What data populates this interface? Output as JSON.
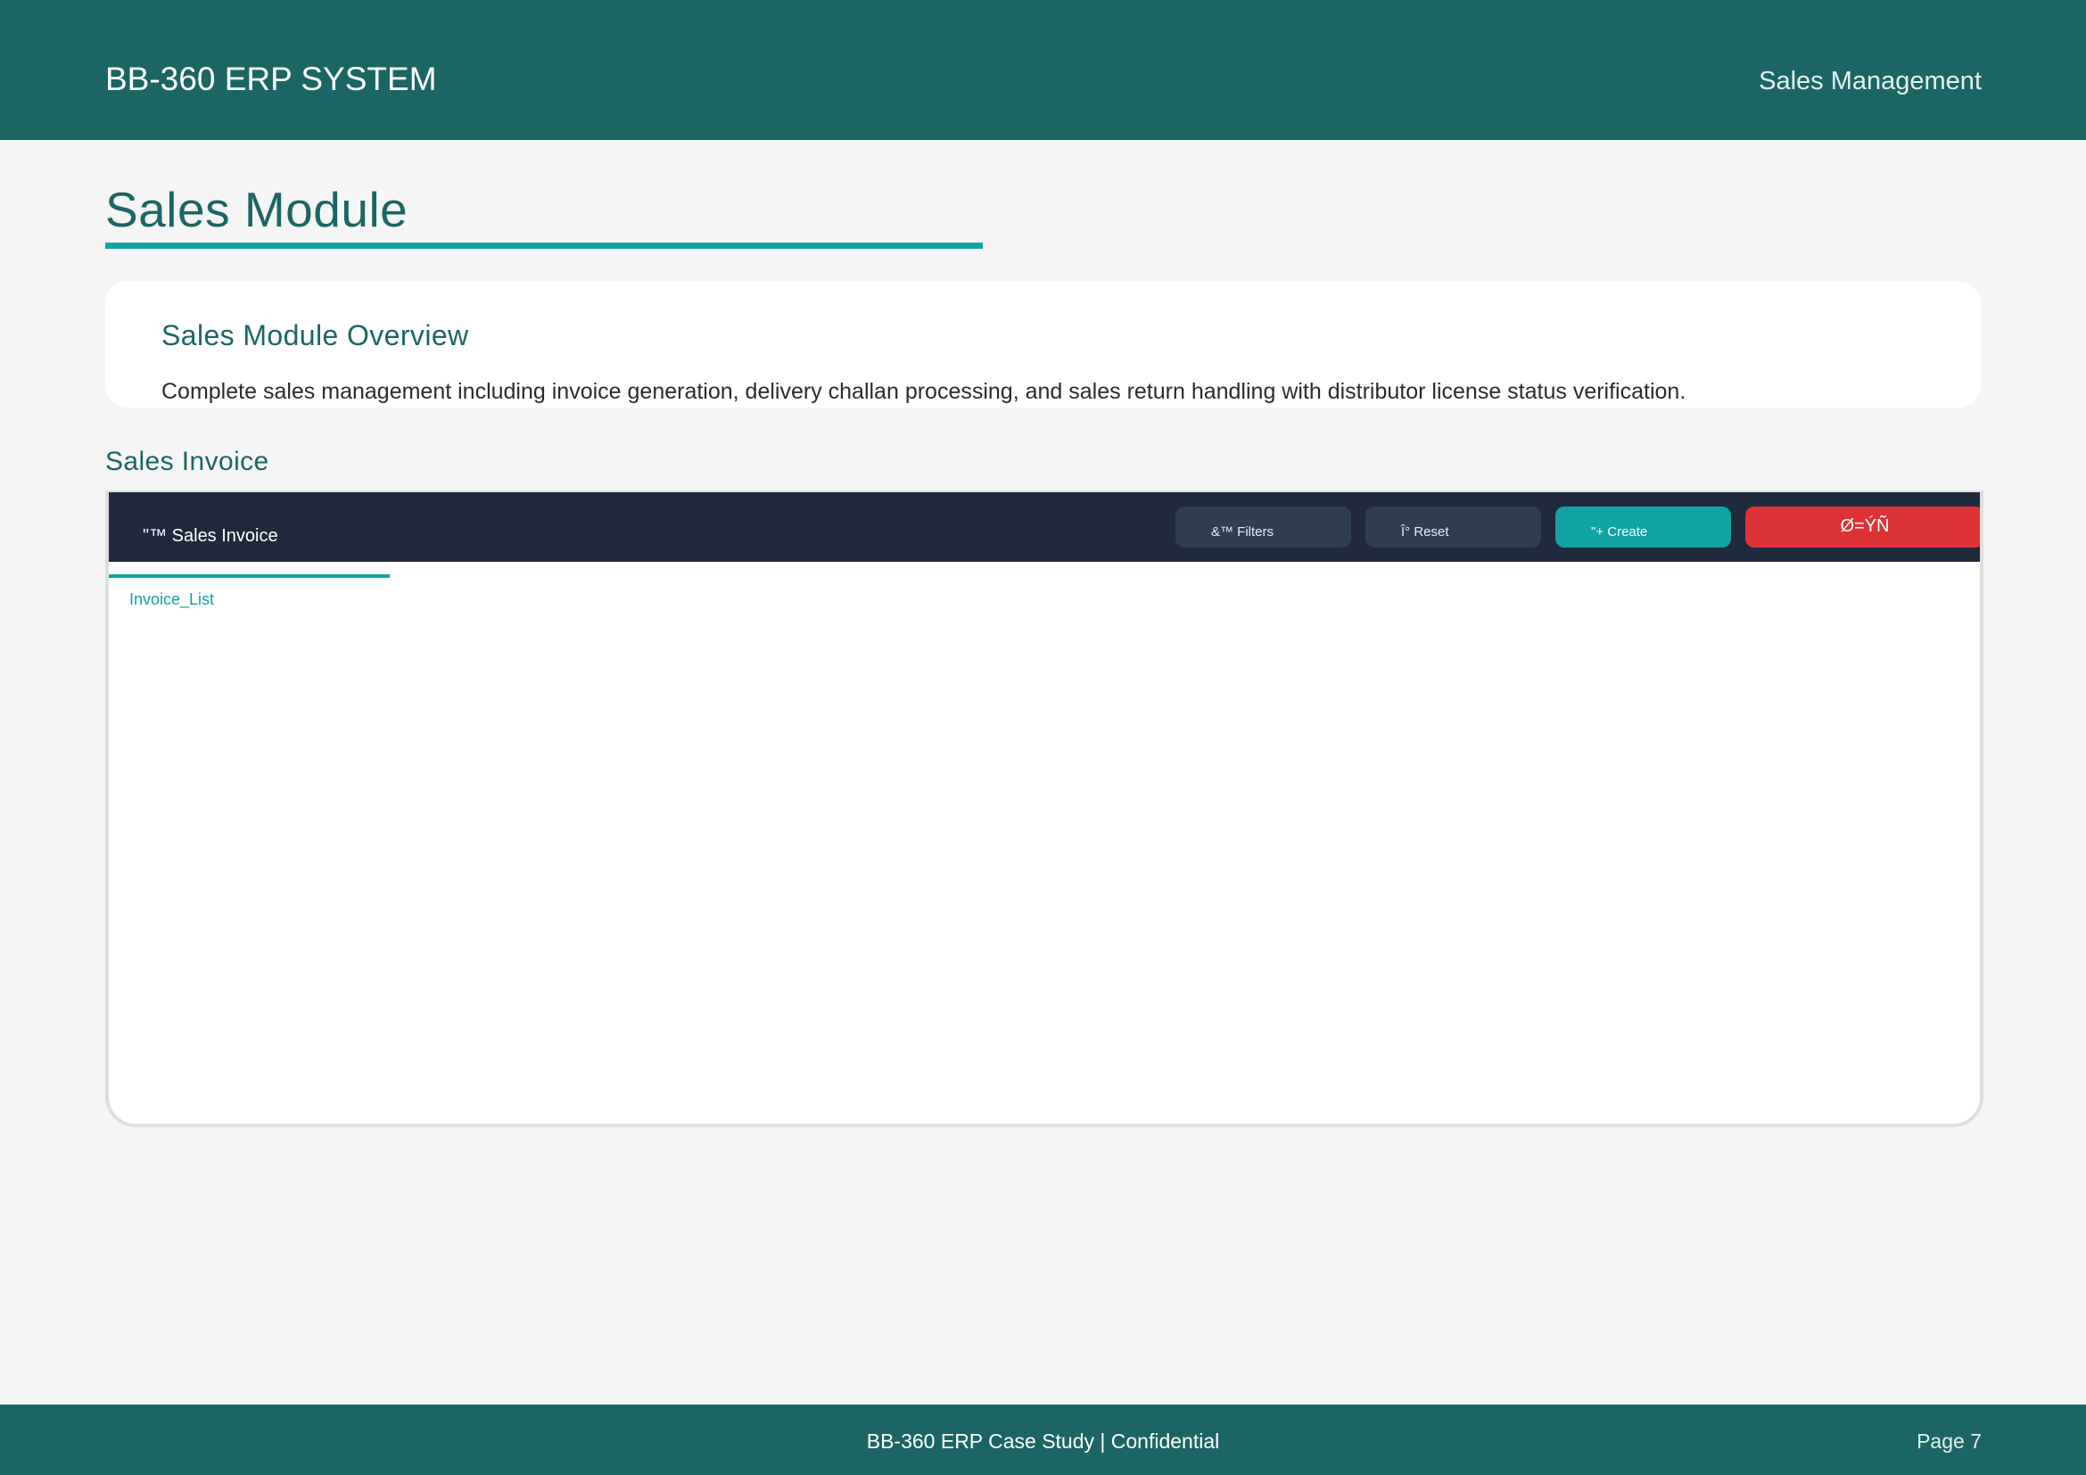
{
  "header": {
    "brand": "BB-360 ERP SYSTEM",
    "section": "Sales Management"
  },
  "page": {
    "title": "Sales Module"
  },
  "overview": {
    "heading": "Sales Module Overview",
    "text": "Complete sales management including invoice generation, delivery challan processing, and sales return handling with distributor license status verification."
  },
  "subsection": {
    "heading": "Sales Invoice"
  },
  "screenshot": {
    "title": "\"™ Sales Invoice",
    "buttons": {
      "filters": "&™ Filters",
      "reset": "Î° Reset",
      "create": "\"+ Create",
      "red": "Ø=ÝÑ"
    },
    "tab": "Invoice_List"
  },
  "footer": {
    "center": "BB-360 ERP Case Study  |  Confidential",
    "page": "Page 7"
  },
  "colors": {
    "primary": "#1b6664",
    "accent": "#12a4a4",
    "dark_bar": "#212a3c",
    "danger": "#dd3336"
  }
}
